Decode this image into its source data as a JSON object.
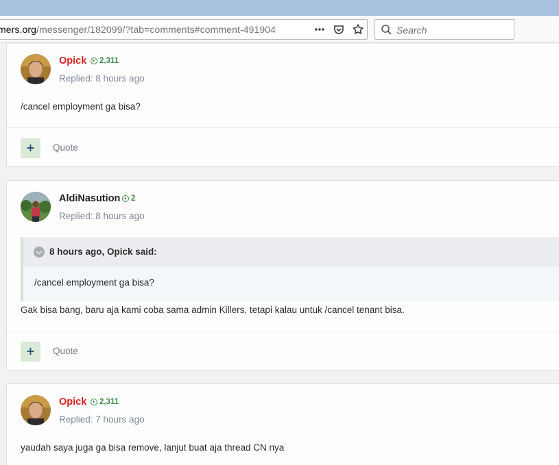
{
  "browser": {
    "url_prefix": "mers.org",
    "url_path": "/messenger/182099/?tab=comments#comment-491904",
    "search_placeholder": "Search",
    "icons": [
      "more-actions-icon",
      "pocket-icon",
      "bookmark-star-icon",
      "search-icon"
    ]
  },
  "comments": [
    {
      "username": "Opick",
      "reputation": "2,311",
      "meta": "Replied: 8 hours ago",
      "text": "/cancel employment ga bisa?",
      "quote_label": "Quote",
      "plus_label": "+"
    },
    {
      "username": "AldiNasution",
      "reputation": "2",
      "meta": "Replied: 8 hours ago",
      "quote": {
        "attribution": "8 hours ago, Opick said:",
        "text": "/cancel employment ga bisa?"
      },
      "text": "Gak bisa bang, baru aja kami coba sama admin Killers, tetapi kalau untuk /cancel tenant bisa.",
      "quote_label": "Quote",
      "plus_label": "+"
    },
    {
      "username": "Opick",
      "reputation": "2,311",
      "meta": "Replied: 7 hours ago",
      "text": "yaudah saya juga ga bisa remove, lanjut buat aja thread CN nya"
    }
  ],
  "colors": {
    "username_highlight": "#d8211e",
    "reputation": "#3c8c46",
    "meta": "#7f8a9a"
  }
}
